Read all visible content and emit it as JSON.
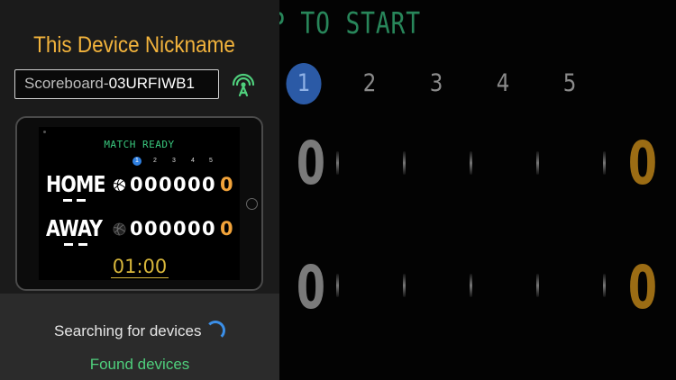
{
  "board": {
    "tap_text": "P TO START",
    "sets": [
      "1",
      "2",
      "3",
      "4",
      "5"
    ],
    "active_set": 1,
    "home_score": "0",
    "home_score_right": "0",
    "away_score": "0",
    "away_score_right": "0"
  },
  "panel": {
    "title": "This Device Nickname",
    "nickname_prefix": "Scoreboard-",
    "nickname_id": "03URFIWB1",
    "broadcast_icon": "broadcast-antenna-icon"
  },
  "preview": {
    "status": "MATCH READY",
    "sets": [
      "1",
      "2",
      "3",
      "4",
      "5"
    ],
    "home": {
      "name": "HOME",
      "digits": [
        "0",
        "0",
        "0",
        "0",
        "0",
        "0",
        "0"
      ]
    },
    "away": {
      "name": "AWAY",
      "digits": [
        "0",
        "0",
        "0",
        "0",
        "0",
        "0",
        "0"
      ]
    },
    "timer": "01:00"
  },
  "footer": {
    "searching": "Searching for devices",
    "found": "Found devices"
  },
  "colors": {
    "accent_orange": "#f2b33c",
    "accent_green": "#4fcf7c",
    "active_blue": "#2b5aa6"
  }
}
